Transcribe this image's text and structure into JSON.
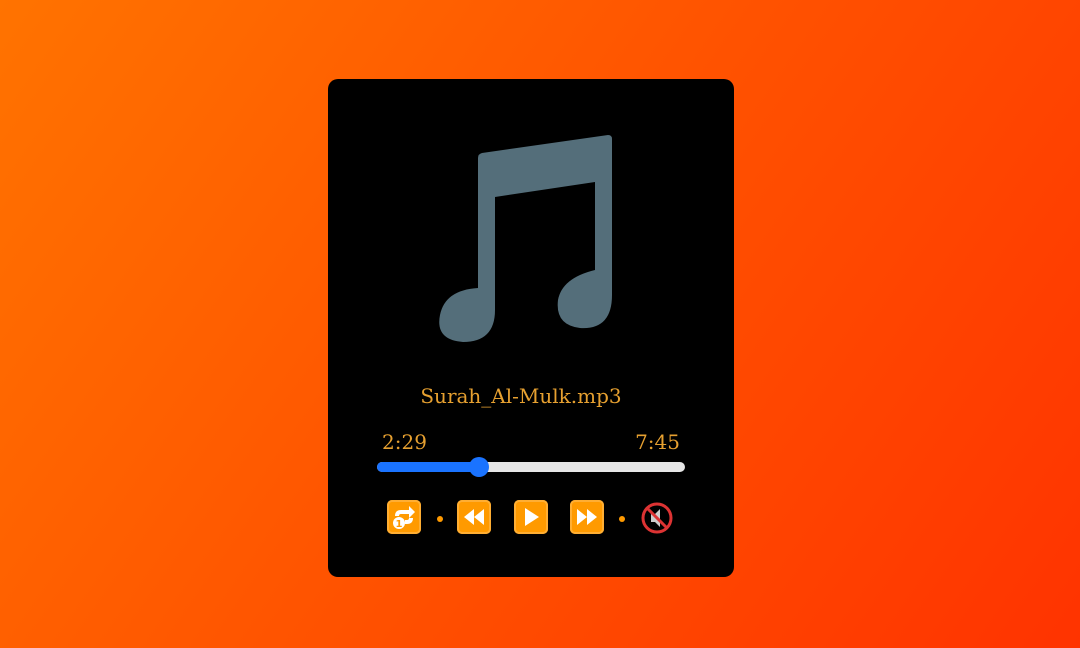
{
  "track": {
    "filename": "Surah_Al-Mulk.mp3",
    "current_time": "2:29",
    "duration": "7:45",
    "progress": 0.33
  },
  "controls": {
    "repeat_icon": "repeat-one-icon",
    "rewind_icon": "rewind-icon",
    "play_icon": "play-icon",
    "forward_icon": "fast-forward-icon",
    "mute_icon": "muted-speaker-icon"
  },
  "colors": {
    "accent": "#e6a030",
    "slider": "#1a73ff",
    "button": "#ff9a00",
    "art": "#546e7a"
  }
}
